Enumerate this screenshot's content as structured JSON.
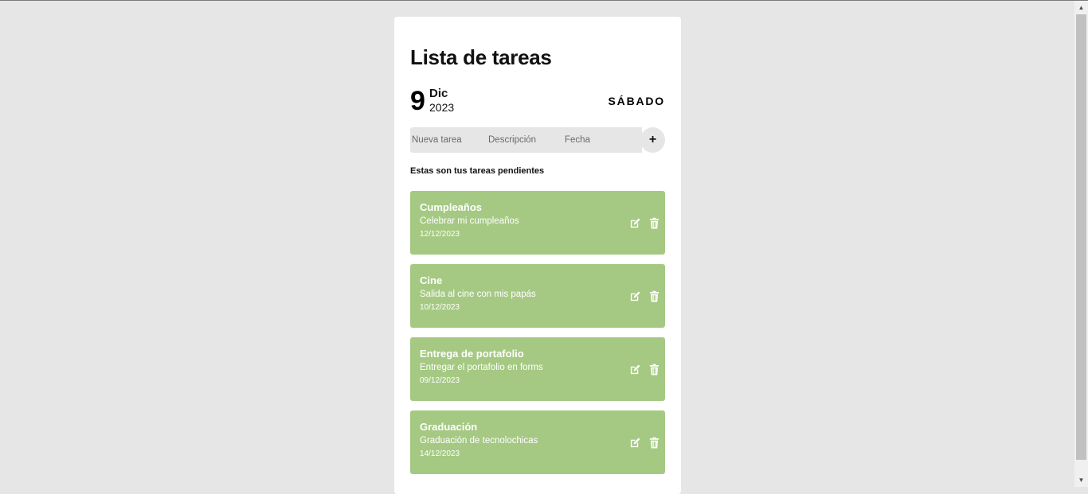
{
  "app": {
    "title": "Lista de tareas"
  },
  "date": {
    "day": "9",
    "month": "Dic",
    "year": "2023",
    "weekday": "SÁBADO"
  },
  "form": {
    "task_placeholder": "Nueva tarea",
    "description_placeholder": "Descripción",
    "date_placeholder": "Fecha",
    "add_label": "+"
  },
  "pending_label": "Estas son tus tareas pendientes",
  "tasks": [
    {
      "title": "Cumpleaños",
      "description": "Celebrar mi cumpleaños",
      "date": "12/12/2023"
    },
    {
      "title": "Cine",
      "description": "Salida al cine con mis papás",
      "date": "10/12/2023"
    },
    {
      "title": "Entrega de portafolio",
      "description": "Entregar el portafolio en forms",
      "date": "09/12/2023"
    },
    {
      "title": "Graduación",
      "description": "Graduación de tecnolochicas",
      "date": "14/12/2023"
    }
  ],
  "icons": {
    "edit": "edit-icon",
    "delete": "trash-icon",
    "scroll_up": "scroll-up-arrow-icon",
    "scroll_down": "scroll-down-arrow-icon"
  },
  "colors": {
    "page_background": "#e6e6e6",
    "card_background": "#ffffff",
    "task_background": "#a5c983",
    "task_text": "#ffffff",
    "input_background": "#e6e6e6"
  }
}
